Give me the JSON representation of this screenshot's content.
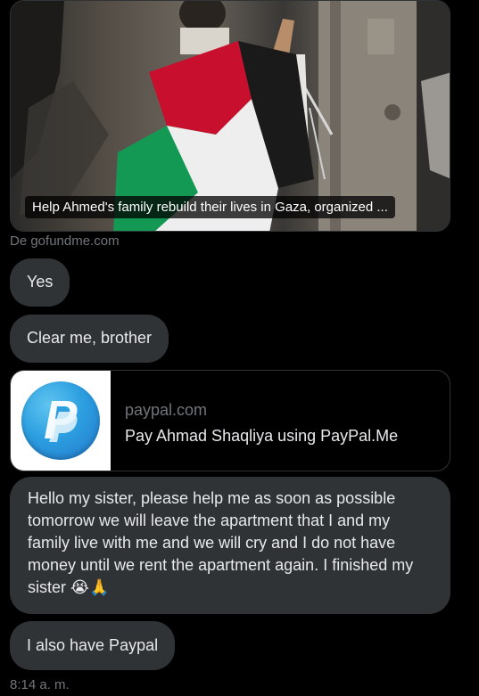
{
  "link_preview": {
    "caption": "Help Ahmed's family rebuild their lives in Gaza, organized ...",
    "source": "De gofundme.com"
  },
  "messages": [
    {
      "text": "Yes"
    },
    {
      "text": "Clear me, brother"
    },
    {
      "text": "Hello my sister, please help me as soon as possible tomorrow we will leave the apartment that I and my family live with me and we will cry and I do not have money until we rent the apartment again. I finished my sister 😭🙏"
    },
    {
      "text": "I also have Paypal"
    }
  ],
  "paypal_card": {
    "domain": "paypal.com",
    "title": "Pay Ahmad Shaqliya using PayPal.Me",
    "icon": "paypal-logo"
  },
  "timestamp": "8:14 a. m.",
  "colors": {
    "background": "#000000",
    "bubble": "#2f3336",
    "muted_text": "#71767b",
    "flag_red": "#c8102e",
    "flag_green": "#149954"
  }
}
